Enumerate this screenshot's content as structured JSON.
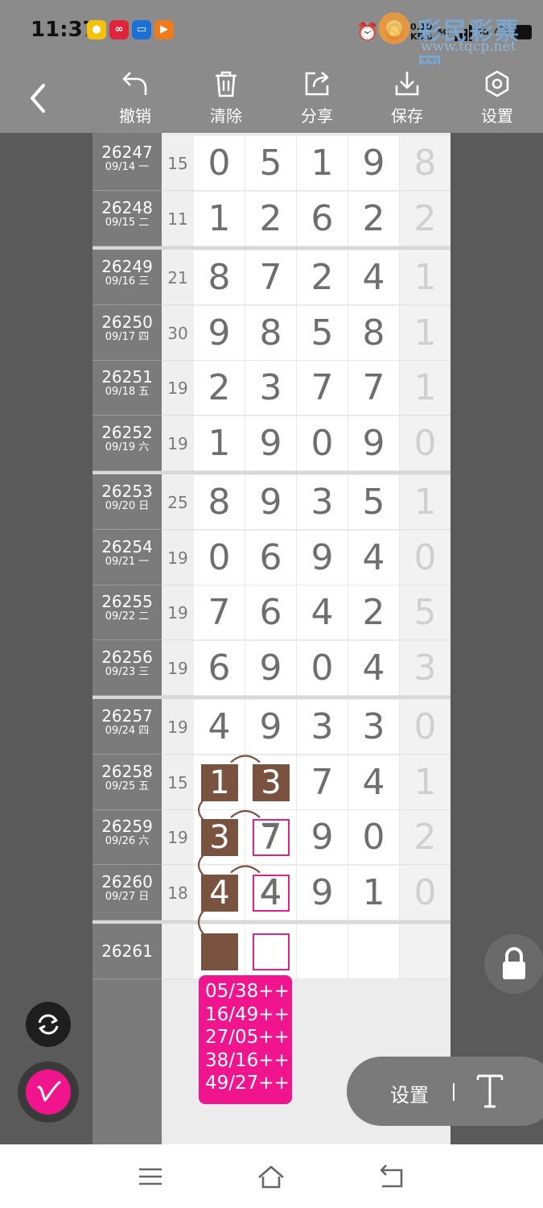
{
  "status_bar": {
    "time": "11:37",
    "speed_value": "0.10",
    "speed_unit": "KB/s",
    "network_1": "5G",
    "network_2": "5G",
    "icons": [
      "alarm-icon",
      "mute-icon",
      "wifi-icon",
      "signal-icon",
      "battery-icon"
    ],
    "app_icons": [
      "app-yellow-icon",
      "app-red-icon",
      "app-blue-icon",
      "app-orange-icon"
    ],
    "app_colors": [
      "#f4c20d",
      "#e0243a",
      "#1d6fd8",
      "#f07b1f"
    ]
  },
  "watermark": {
    "title": "彩民彩票网",
    "url": "www.tqcp.net"
  },
  "toolbar": {
    "back_icon": "back-arrow-icon",
    "buttons": [
      {
        "label": "撤销",
        "icon": "undo-icon"
      },
      {
        "label": "清除",
        "icon": "trash-icon"
      },
      {
        "label": "分享",
        "icon": "share-icon"
      },
      {
        "label": "保存",
        "icon": "download-icon"
      },
      {
        "label": "设置",
        "icon": "settings-hex-icon"
      }
    ]
  },
  "rows": [
    {
      "issue": "26247",
      "date": "09/14 一",
      "sum": "15",
      "digits": [
        "0",
        "5",
        "1",
        "9"
      ],
      "last": "8"
    },
    {
      "issue": "26248",
      "date": "09/15 二",
      "sum": "11",
      "digits": [
        "1",
        "2",
        "6",
        "2"
      ],
      "last": "2"
    },
    {
      "issue": "26249",
      "date": "09/16 三",
      "sum": "21",
      "digits": [
        "8",
        "7",
        "2",
        "4"
      ],
      "last": "1"
    },
    {
      "issue": "26250",
      "date": "09/17 四",
      "sum": "30",
      "digits": [
        "9",
        "8",
        "5",
        "8"
      ],
      "last": "1"
    },
    {
      "issue": "26251",
      "date": "09/18 五",
      "sum": "19",
      "digits": [
        "2",
        "3",
        "7",
        "7"
      ],
      "last": "1"
    },
    {
      "issue": "26252",
      "date": "09/19 六",
      "sum": "19",
      "digits": [
        "1",
        "9",
        "0",
        "9"
      ],
      "last": "0"
    },
    {
      "issue": "26253",
      "date": "09/20 日",
      "sum": "25",
      "digits": [
        "8",
        "9",
        "3",
        "5"
      ],
      "last": "1"
    },
    {
      "issue": "26254",
      "date": "09/21 一",
      "sum": "19",
      "digits": [
        "0",
        "6",
        "9",
        "4"
      ],
      "last": "0"
    },
    {
      "issue": "26255",
      "date": "09/22 二",
      "sum": "19",
      "digits": [
        "7",
        "6",
        "4",
        "2"
      ],
      "last": "5"
    },
    {
      "issue": "26256",
      "date": "09/23 三",
      "sum": "19",
      "digits": [
        "6",
        "9",
        "0",
        "4"
      ],
      "last": "3"
    },
    {
      "issue": "26257",
      "date": "09/24 四",
      "sum": "19",
      "digits": [
        "4",
        "9",
        "3",
        "3"
      ],
      "last": "0"
    },
    {
      "issue": "26258",
      "date": "09/25 五",
      "sum": "15",
      "digits": [
        "1",
        "3",
        "7",
        "4"
      ],
      "last": "1"
    },
    {
      "issue": "26259",
      "date": "09/26 六",
      "sum": "19",
      "digits": [
        "3",
        "7",
        "9",
        "0"
      ],
      "last": "2"
    },
    {
      "issue": "26260",
      "date": "09/27 日",
      "sum": "18",
      "digits": [
        "4",
        "4",
        "9",
        "1"
      ],
      "last": "0"
    },
    {
      "issue": "26261",
      "date": "",
      "sum": "",
      "digits": [
        "",
        "",
        "",
        ""
      ],
      "last": ""
    }
  ],
  "annotations": {
    "fill_color": "#7a5240",
    "frame_color": "#e0208c",
    "filled_cells": [
      "26258-1",
      "26258-2",
      "26259-1",
      "26260-1",
      "26261-1"
    ],
    "framed_cells": [
      "26259-2",
      "26260-2",
      "26261-2"
    ]
  },
  "note": {
    "lines": [
      "05/38++",
      "16/49++",
      "27/05++",
      "38/16++",
      "49/27++"
    ],
    "color": "#f0158c"
  },
  "floating": {
    "refresh_icon": "refresh-icon",
    "pen_icon": "pen-icon",
    "lock_icon": "lock-icon",
    "settings_label": "设置",
    "text_icon": "text-tool-icon"
  },
  "navbar": {
    "icons": [
      "menu-icon",
      "home-icon",
      "back-icon"
    ]
  }
}
